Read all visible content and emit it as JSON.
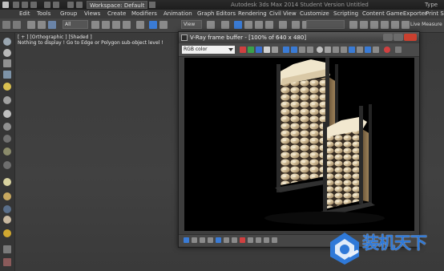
{
  "titlebar": {
    "workspace": "Workspace: Default",
    "app_title": "Autodesk 3ds Max 2014   Student Version   Untitled",
    "search": "Type"
  },
  "menu": [
    "Edit",
    "Tools",
    "Group",
    "Views",
    "Create",
    "Modifiers",
    "Animation",
    "Graph Editors",
    "Rendering",
    "Civil View",
    "Customize",
    "Scripting",
    "Content",
    "GameExporter",
    "Print Se"
  ],
  "toolbar": {
    "filter": "All",
    "view": "View",
    "live_measure": "Live Measure"
  },
  "viewport": {
    "label": "[ + ] [Orthographic ] [Shaded ]",
    "hint": "Nothing to display ! Go to Edge or Polygon sub-object level !"
  },
  "vfb": {
    "title": "V-Ray frame buffer - [100% of 640 x 480]",
    "channel": "RGB color"
  },
  "colors": {
    "accent_blue": "#3a7bd5",
    "watermark": "#2f79d8"
  },
  "watermark": {
    "text": "装机天下"
  }
}
